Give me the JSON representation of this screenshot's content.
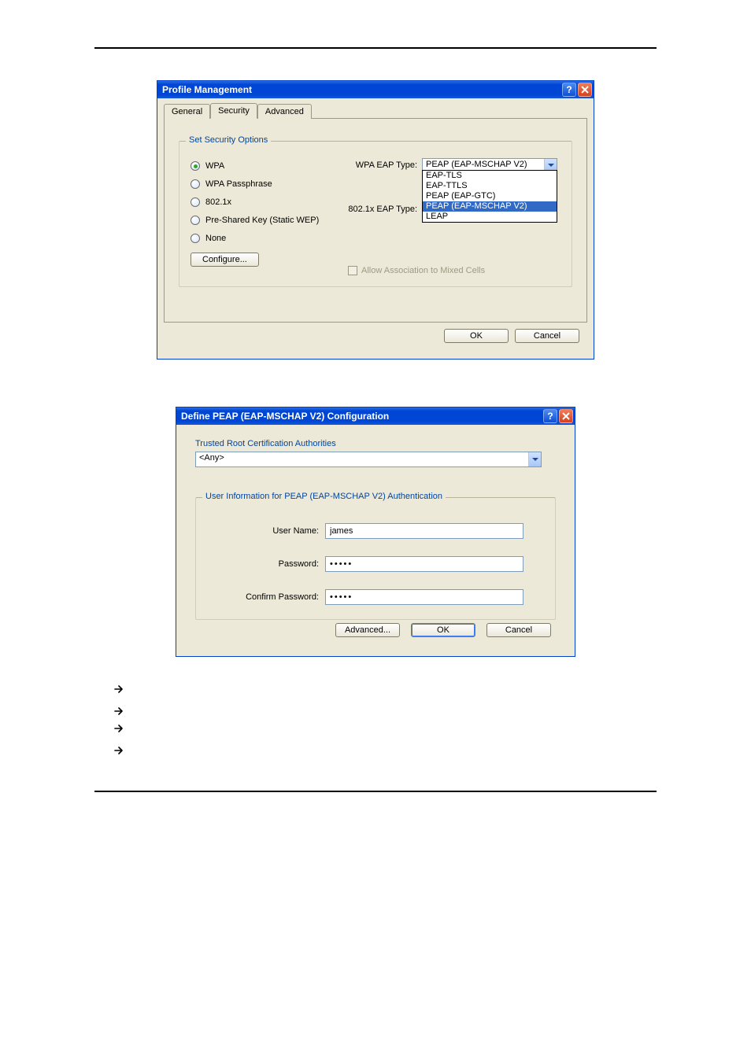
{
  "dialog1": {
    "title": "Profile Management",
    "tabs": [
      {
        "label": "General"
      },
      {
        "label": "Security"
      },
      {
        "label": "Advanced"
      }
    ],
    "fieldset_legend": "Set Security Options",
    "radios": [
      {
        "label": "WPA",
        "checked": true
      },
      {
        "label": "WPA Passphrase",
        "checked": false
      },
      {
        "label": "802.1x",
        "checked": false
      },
      {
        "label": "Pre-Shared Key (Static WEP)",
        "checked": false
      },
      {
        "label": "None",
        "checked": false
      }
    ],
    "configure_button": "Configure...",
    "wpa_type_label": "WPA EAP Type:",
    "wpa_type_value": "PEAP (EAP-MSCHAP V2)",
    "x_type_label": "802.1x EAP Type:",
    "dropdown_options": [
      "EAP-TLS",
      "EAP-TTLS",
      "PEAP (EAP-GTC)",
      "PEAP (EAP-MSCHAP V2)",
      "LEAP"
    ],
    "dropdown_selected_index": 3,
    "mixed_cells_label": "Allow Association to Mixed Cells",
    "ok_label": "OK",
    "cancel_label": "Cancel"
  },
  "dialog2": {
    "title": "Define PEAP (EAP-MSCHAP V2) Configuration",
    "trusted_label": "Trusted Root Certification Authorities",
    "trusted_value": "<Any>",
    "fieldset_legend": "User Information for PEAP (EAP-MSCHAP V2) Authentication",
    "username_label": "User Name:",
    "username_value": "james",
    "password_label": "Password:",
    "password_value": "•••••",
    "confirm_label": "Confirm Password:",
    "confirm_value": "•••••",
    "advanced_label": "Advanced...",
    "ok_label": "OK",
    "cancel_label": "Cancel"
  }
}
